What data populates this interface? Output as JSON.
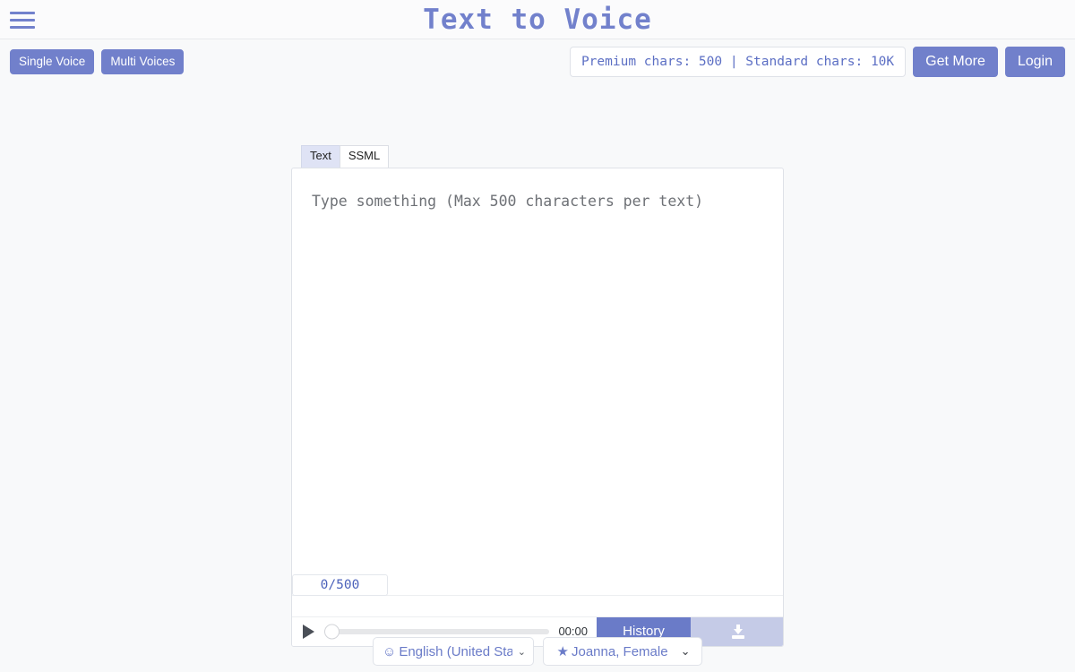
{
  "header": {
    "title": "Text to Voice",
    "menu_icon": "hamburger-icon"
  },
  "actionbar": {
    "single_voice": "Single Voice",
    "multi_voices": "Multi Voices",
    "chars_status": "Premium chars: 500 | Standard chars: 10K",
    "get_more": "Get More",
    "login": "Login"
  },
  "editor": {
    "tabs": [
      {
        "label": "Text",
        "active": true
      },
      {
        "label": "SSML",
        "active": false
      }
    ],
    "placeholder": "Type something (Max 500 characters per text)",
    "value": "",
    "counter": "0/500"
  },
  "player": {
    "play_icon": "play-icon",
    "time": "00:00",
    "progress": 0,
    "history_label": "History",
    "download_icon": "download-icon",
    "download_enabled": false
  },
  "footer": {
    "language": {
      "icon": "☺",
      "value": "English (United States)",
      "chevron": "⌄"
    },
    "voice": {
      "icon": "★",
      "value": "Joanna, Female",
      "chevron": "⌄"
    }
  },
  "colors": {
    "accent": "#7180cb",
    "accent_dark": "#6a7bc8",
    "accent_light": "#c5cbe7",
    "tab_active_bg": "#dfe3f5",
    "page_bg": "#f8f9fa",
    "counter_text": "#4d63bb"
  }
}
